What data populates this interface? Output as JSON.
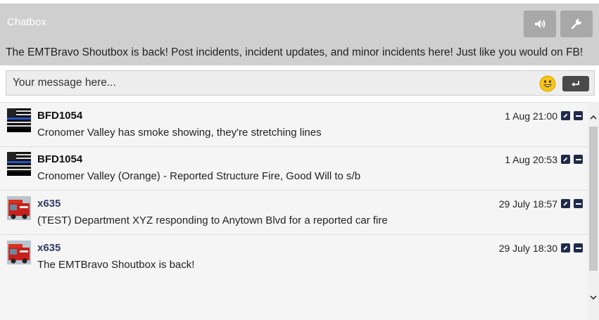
{
  "header": {
    "title": "Chatbox",
    "announcement": "The EMTBravo Shoutbox is back! Post incidents, incident updates, and minor incidents here! Just like you would on FB!",
    "buttons": [
      {
        "icon": "speaker-icon"
      },
      {
        "icon": "wrench-icon"
      }
    ]
  },
  "input": {
    "placeholder": "Your message here...",
    "emoji_icon": "smiley-icon",
    "send_icon": "enter-icon"
  },
  "messages": [
    {
      "user": "BFD1054",
      "avatar": "thin-blue-line-flag",
      "time": "1 Aug 21:00",
      "text": "Cronomer Valley has smoke showing, they're stretching lines"
    },
    {
      "user": "BFD1054",
      "avatar": "thin-blue-line-flag",
      "time": "1 Aug 20:53",
      "text": "Cronomer Valley (Orange) - Reported Structure Fire, Good Will to s/b"
    },
    {
      "user": "x635",
      "avatar": "fire-truck",
      "time": "29 July 18:57",
      "text": "(TEST) Department XYZ responding to Anytown Blvd for a reported car fire"
    },
    {
      "user": "x635",
      "avatar": "fire-truck",
      "time": "29 July 18:30",
      "text": "The EMTBravo Shoutbox is back!"
    }
  ],
  "colors": {
    "header_bg": "#cfcfcf",
    "button_bg": "#a8a8a8",
    "username_blue": "#2f3d66",
    "icon_navy": "#1f2b4a"
  }
}
